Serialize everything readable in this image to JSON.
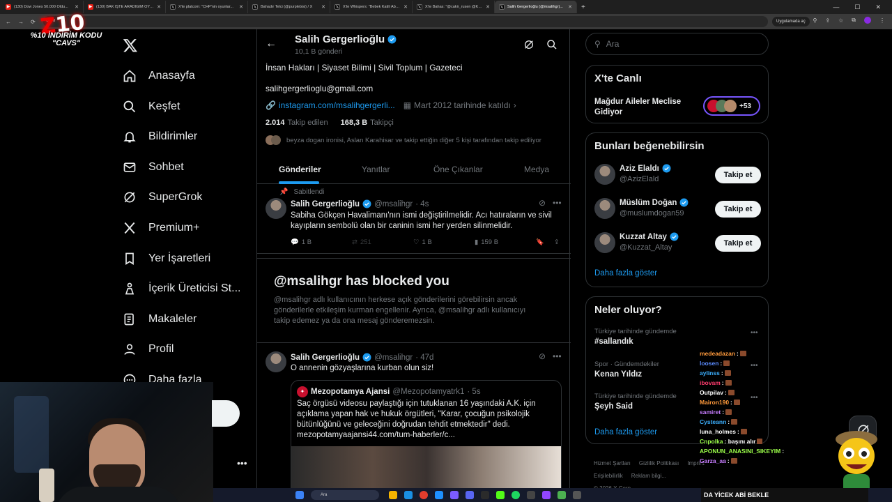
{
  "browser": {
    "tabs": [
      {
        "title": "(130) Dow Jones 50.000 Oldu...",
        "icon": "youtube-icon"
      },
      {
        "title": "(130) BAK İŞTE ARADIĞIM OYU...",
        "icon": "youtube-icon"
      },
      {
        "title": "X'te platcom: \"CHP'nin oyunlar...",
        "icon": "x-icon"
      },
      {
        "title": "Bahadır Telci (@purplebisi) / X",
        "icon": "x-icon"
      },
      {
        "title": "X'te Whispers: \"Bebek Katili Abd...",
        "icon": "x-icon"
      },
      {
        "title": "X'te Bahas: \"@cakir_rusen @Ka...",
        "icon": "x-icon"
      },
      {
        "title": "Salih Gergerlioğlu (@msalihgr)...",
        "icon": "x-icon",
        "active": true
      }
    ],
    "url_fragment": "com",
    "apps_label": "Uygulamada aç"
  },
  "overlay": {
    "logo_text": "Z10",
    "promo_text": "%10 İNDİRİM KODU \"CAVS\"",
    "banner_text": "DA YİCEK ABİ BEKLE"
  },
  "nav": {
    "items": [
      {
        "label": "Anasayfa",
        "icon": "home-icon"
      },
      {
        "label": "Keşfet",
        "icon": "search-icon"
      },
      {
        "label": "Bildirimler",
        "icon": "bell-icon"
      },
      {
        "label": "Sohbet",
        "icon": "mail-icon"
      },
      {
        "label": "SuperGrok",
        "icon": "grok-icon"
      },
      {
        "label": "Premium+",
        "icon": "x-premium-icon"
      },
      {
        "label": "Yer İşaretleri",
        "icon": "bookmark-icon"
      },
      {
        "label": "İçerik Üreticisi St...",
        "icon": "creator-studio-icon"
      },
      {
        "label": "Makaleler",
        "icon": "articles-icon"
      },
      {
        "label": "Profil",
        "icon": "profile-icon"
      },
      {
        "label": "Daha fazla",
        "icon": "more-circle-icon"
      }
    ]
  },
  "profile": {
    "name": "Salih Gergerlioğlu",
    "posts_count": "10,1 B gönderi",
    "bio": "İnsan Hakları | Siyaset Bilimi | Sivil Toplum | Gazeteci",
    "email": "salihgergerlioglu@gmail.com",
    "link": "instagram.com/msalihgergerli...",
    "joined": "Mart 2012 tarihinde katıldı",
    "following_count": "2.014",
    "following_label": "Takip edilen",
    "followers_count": "168,3 B",
    "followers_label": "Takipçi",
    "followed_by": "beyza dogan ironisi, Aslan Karahisar ve takip ettiğin diğer 5 kişi tarafından takip ediliyor",
    "tabs": [
      "Gönderiler",
      "Yanıtlar",
      "Öne Çıkanlar",
      "Medya"
    ]
  },
  "pinned": {
    "pinned_label": "Sabitlendi",
    "name": "Salih Gergerlioğlu",
    "handle": "@msalihgr",
    "time": "· 4s",
    "text": "Sabiha Gökçen Havalimanı'nın ismi değiştirilmelidir. Acı hatıraların ve sivil kayıpların sembolü olan bir caninin ismi her yerden silinmelidir.",
    "replies": "1 B",
    "reposts": "251",
    "likes": "1 B",
    "views": "159 B"
  },
  "blocked": {
    "title": "@msalihgr has blocked you",
    "text": "@msalihgr adlı kullanıcının herkese açık gönderilerini görebilirsin ancak gönderilerle etkileşim kurman engellenir. Ayrıca, @msalihgr adlı kullanıcıyı takip edemez ya da ona mesaj gönderemezsin."
  },
  "tweet2": {
    "name": "Salih Gergerlioğlu",
    "handle": "@msalihgr",
    "time": "· 47d",
    "text": "O annenin gözyaşlarına kurban olun siz!",
    "quote": {
      "name": "Mezopotamya Ajansi",
      "handle": "@Mezopotamyatrk1",
      "time": "· 5s",
      "text": "Saç örgüsü videosu paylaştığı için tutuklanan 16 yaşındaki A.K. için açıklama yapan hak ve hukuk örgütleri, \"Karar, çocuğun psikolojik bütünlüğünü ve geleceğini doğrudan tehdit etmektedir\" dedi. mezopotamyaajansi44.com/tum-haberler/c..."
    }
  },
  "search": {
    "placeholder": "Ara"
  },
  "live": {
    "title": "X'te Canlı",
    "event": "Mağdur Aileler Meclise Gidiyor",
    "count": "+53"
  },
  "suggest": {
    "title": "Bunları beğenebilirsin",
    "follow_label": "Takip et",
    "show_more": "Daha fazla göster",
    "users": [
      {
        "name": "Aziz Elaldı",
        "handle": "@AzizElald"
      },
      {
        "name": "Müslüm Doğan",
        "handle": "@muslumdogan59"
      },
      {
        "name": "Kuzzat Altay",
        "handle": "@Kuzzat_Altay"
      }
    ]
  },
  "trends": {
    "title": "Neler oluyor?",
    "show_more": "Daha fazla göster",
    "items": [
      {
        "meta": "Türkiye tarihinde gündemde",
        "name": "#sallandık"
      },
      {
        "meta": "Spor · Gündemdekiler",
        "name": "Kenan Yıldız"
      },
      {
        "meta": "Türkiye tarihinde gündemde",
        "name": "Şeyh Said"
      }
    ]
  },
  "footer": {
    "links": [
      "Hizmet Şartları",
      "Gizlilik Politikası",
      "Imprint",
      "Erişilebilirlik",
      "Reklam bilgi..."
    ],
    "copyright": "© 2026 X Corp."
  },
  "chat": {
    "lines": [
      {
        "user": "medeadazan",
        "text": ":",
        "color": "#ff9a3c"
      },
      {
        "user": "loosen",
        "text": ":",
        "color": "#5b8cff"
      },
      {
        "user": "aylinss",
        "text": ":",
        "color": "#3cb0ff"
      },
      {
        "user": "ibovam",
        "text": ":",
        "color": "#ff3c6e"
      },
      {
        "user": "Outpilav",
        "text": ":",
        "color": "#ffffff"
      },
      {
        "user": "Mairon190",
        "text": ":",
        "color": "#ff9a3c"
      },
      {
        "user": "samiret",
        "text": ":",
        "color": "#c77dff"
      },
      {
        "user": "Cysteann",
        "text": ":",
        "color": "#3cb0ff"
      },
      {
        "user": "luna_holmes",
        "text": ":",
        "color": "#ffffff"
      },
      {
        "user": "Cnpolka",
        "text": ": başını alır",
        "color": "#9cff4a"
      },
      {
        "user": "APONUN_ANASINI_SIKEYIM",
        "text": ":",
        "color": "#9cff4a"
      },
      {
        "user": "Garza_aa",
        "text": ":",
        "color": "#c77dff"
      }
    ]
  },
  "taskbar": {
    "search_placeholder": "Ara"
  },
  "colors": {
    "accent": "#1d9bf0",
    "bg": "#000000",
    "border": "#2f3336"
  }
}
